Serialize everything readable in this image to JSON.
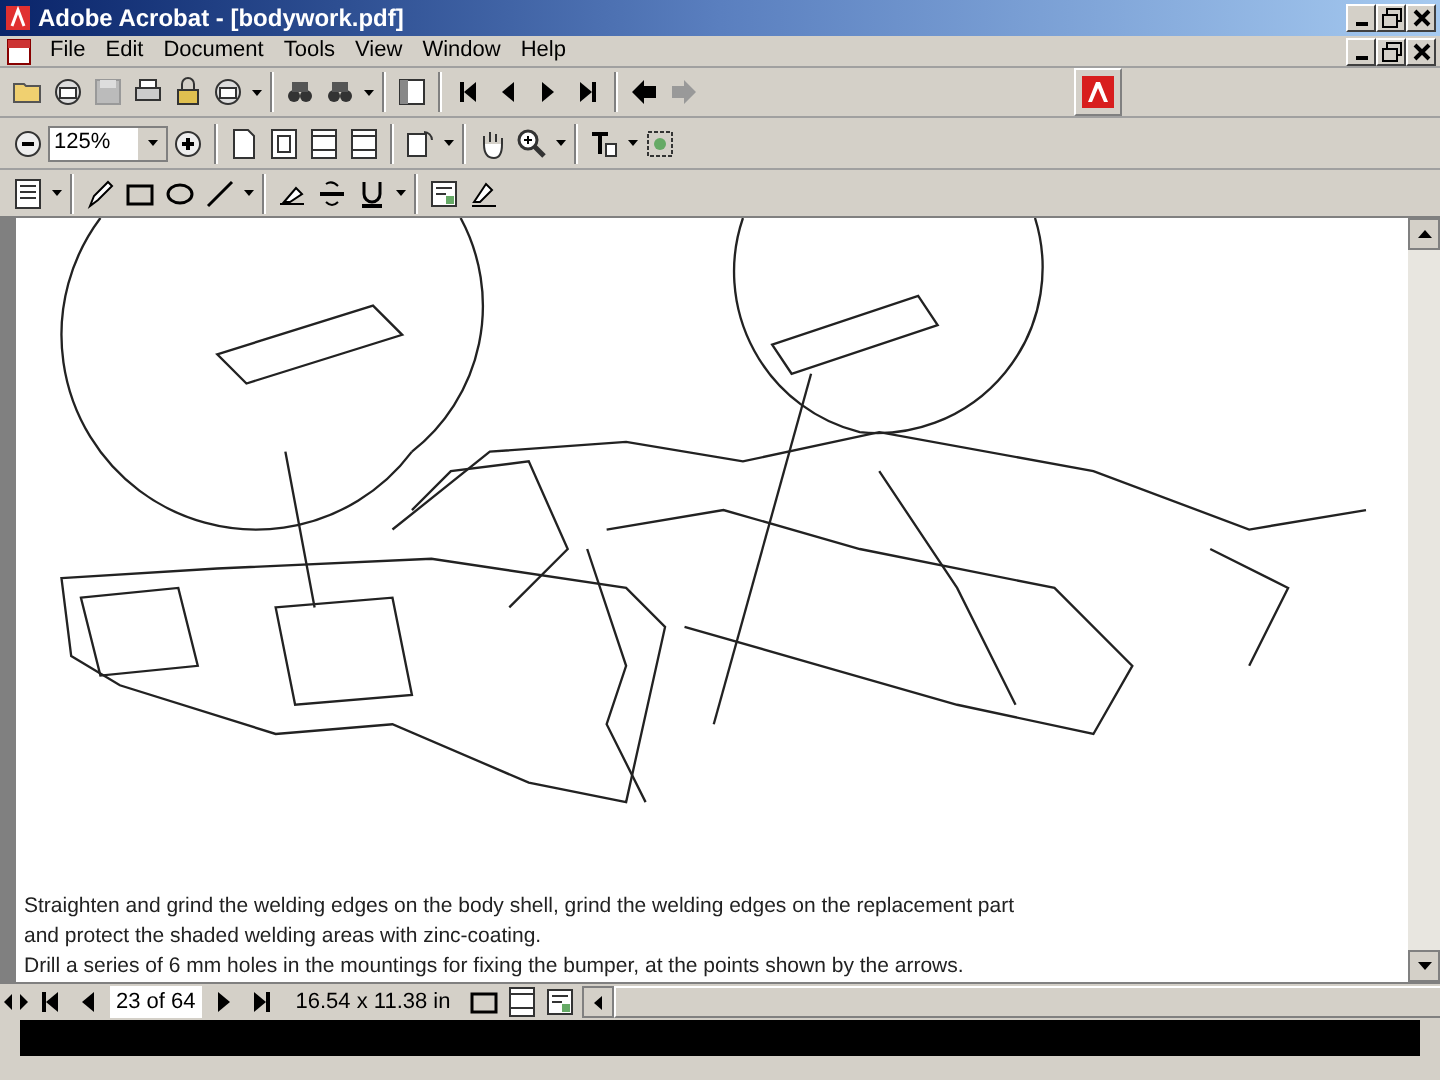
{
  "window": {
    "title": "Adobe Acrobat - [bodywork.pdf]"
  },
  "menu": [
    "File",
    "Edit",
    "Document",
    "Tools",
    "View",
    "Window",
    "Help"
  ],
  "zoom": {
    "value": "125%"
  },
  "page_text": [
    "Straighten and grind the welding edges on the body shell, grind the welding edges on the replacement part",
    "and protect the shaded welding areas with zinc-coating.",
    "Drill a series of 6 mm holes in the mountings for fixing the bumper, at the points shown by the arrows."
  ],
  "status_bar": {
    "page": "23 of 64",
    "page_size": "16.54 x 11.38 in"
  }
}
